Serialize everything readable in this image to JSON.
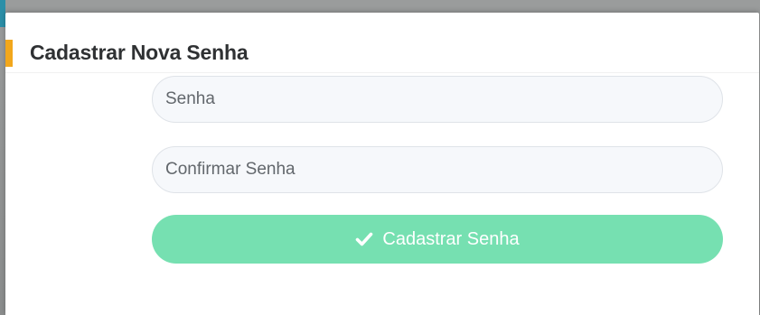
{
  "modal": {
    "title": "Cadastrar Nova Senha",
    "accent_color": "#f2a71c"
  },
  "form": {
    "password_field": {
      "placeholder": "Senha",
      "value": ""
    },
    "confirm_field": {
      "placeholder": "Confirmar Senha",
      "value": ""
    },
    "submit": {
      "label": "Cadastrar Senha",
      "icon": "check-icon",
      "color": "#76e0b1"
    }
  }
}
